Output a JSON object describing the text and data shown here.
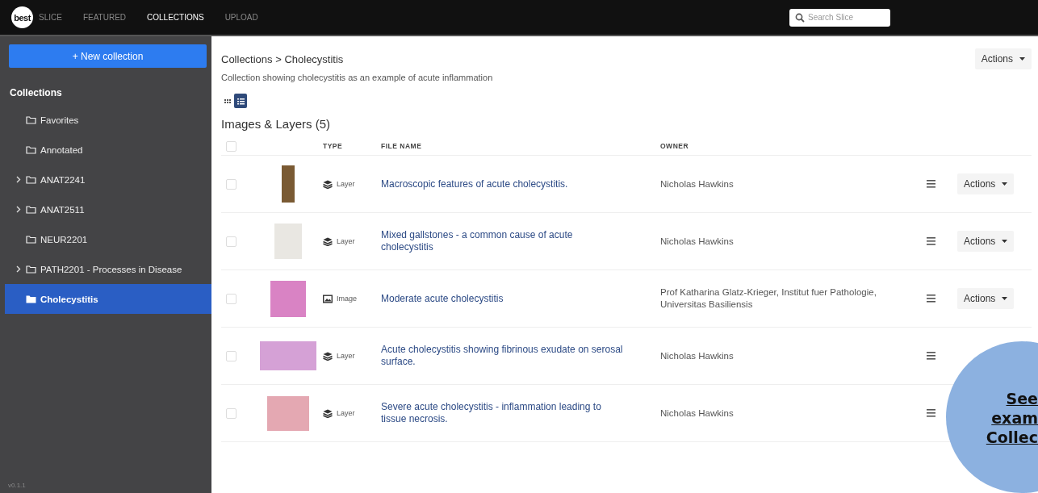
{
  "topbar": {
    "logo": "best",
    "nav": [
      {
        "label": "SLICE",
        "selected": false
      },
      {
        "label": "FEATURED",
        "selected": false
      },
      {
        "label": "COLLECTIONS",
        "selected": true
      },
      {
        "label": "UPLOAD",
        "selected": false
      }
    ],
    "search": {
      "placeholder": "Search Slice"
    }
  },
  "sidebar": {
    "new_button": "+ New collection",
    "heading": "Collections",
    "items": [
      {
        "label": "Favorites",
        "has_children": false,
        "selected": false
      },
      {
        "label": "Annotated",
        "has_children": false,
        "selected": false
      },
      {
        "label": "ANAT2241",
        "has_children": true,
        "selected": false
      },
      {
        "label": "ANAT2511",
        "has_children": true,
        "selected": false
      },
      {
        "label": "NEUR2201",
        "has_children": false,
        "selected": false
      },
      {
        "label": "PATH2201 - Processes in Disease",
        "has_children": true,
        "selected": false
      },
      {
        "label": "Cholecystitis",
        "has_children": false,
        "selected": true
      }
    ],
    "version": "v0.1.1"
  },
  "main": {
    "breadcrumb": "Collections > Cholecystitis",
    "actions": "Actions",
    "description": "Collection showing cholecystitis as an example of acute inflammation",
    "views": [
      {
        "kind": "grid",
        "selected": false
      },
      {
        "kind": "list",
        "selected": true
      }
    ],
    "section_title": "Images & Layers (5)",
    "table": {
      "select_all_checked": false,
      "columns": [
        "TYPE",
        "FILE NAME",
        "OWNER"
      ],
      "rows": [
        {
          "checked": false,
          "type": "Layer",
          "kind": "layer",
          "file_name": "Macroscopic features of acute cholecystitis.",
          "owner": "Nicholas Hawkins",
          "actions": "Actions"
        },
        {
          "checked": false,
          "type": "Layer",
          "kind": "layer",
          "file_name": "Mixed gallstones - a common cause of acute cholecystitis",
          "owner": "Nicholas Hawkins",
          "actions": "Actions"
        },
        {
          "checked": false,
          "type": "Image",
          "kind": "image",
          "file_name": "Moderate acute cholecystitis",
          "owner": "Prof Katharina Glatz-Krieger, Institut fuer Pathologie, Universitas Basiliensis",
          "actions": "Actions"
        },
        {
          "checked": false,
          "type": "Layer",
          "kind": "layer",
          "file_name": "Acute cholecystitis showing fibrinous exudate on serosal surface.",
          "owner": "Nicholas Hawkins"
        },
        {
          "checked": false,
          "type": "Layer",
          "kind": "layer",
          "file_name": "Severe acute cholecystitis - inflammation leading to tissue necrosis.",
          "owner": "Nicholas Hawkins"
        }
      ]
    }
  },
  "callout": {
    "lines": [
      "See",
      "exam",
      "Collec"
    ]
  }
}
